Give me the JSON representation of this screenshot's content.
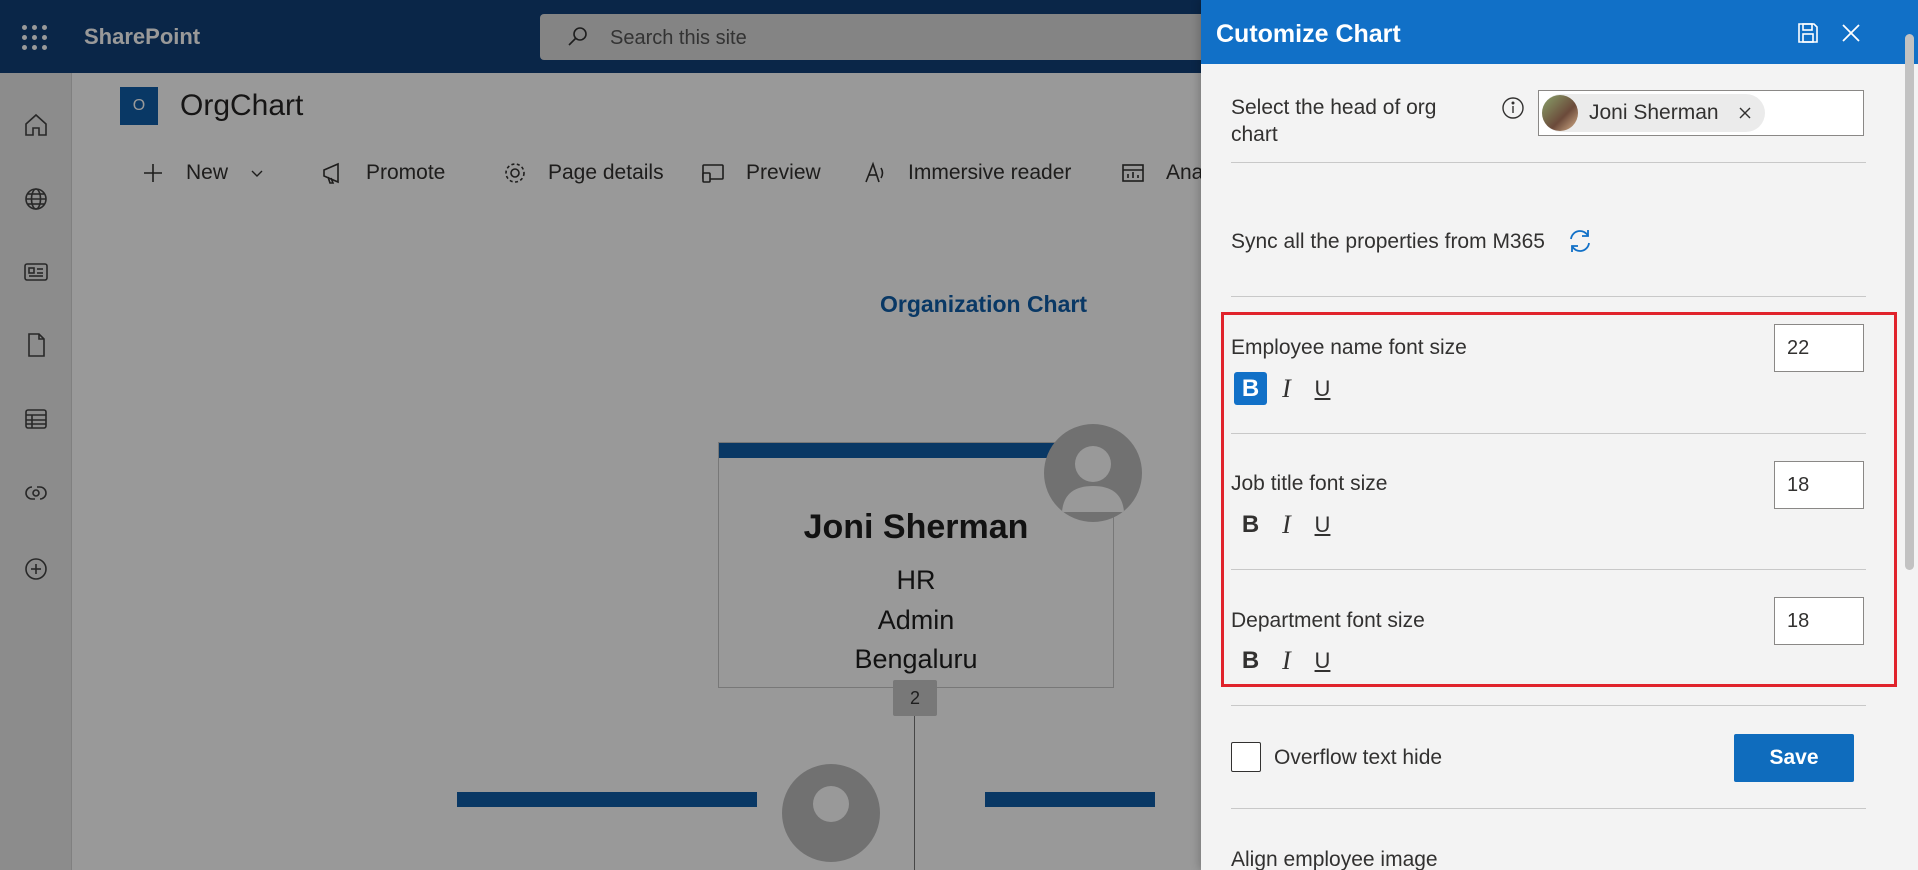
{
  "suite_bar": {
    "app_name": "SharePoint",
    "search_placeholder": "Search this site",
    "background_color": "#124078"
  },
  "left_rail": {
    "icons": [
      "home-icon",
      "globe-icon",
      "news-icon",
      "document-icon",
      "list-icon",
      "loop-icon",
      "add-icon"
    ]
  },
  "site": {
    "logo_letter": "O",
    "title": "OrgChart"
  },
  "command_bar": {
    "new_label": "New",
    "promote_label": "Promote",
    "page_details_label": "Page details",
    "preview_label": "Preview",
    "immersive_reader_label": "Immersive reader",
    "analytics_label": "Ana"
  },
  "org_chart": {
    "title": "Organization Chart",
    "root": {
      "name": "Joni Sherman",
      "job_title": "HR",
      "department": "Admin",
      "location": "Bengaluru",
      "reports_count": "2"
    }
  },
  "panel": {
    "title": "Cutomize Chart",
    "head_label": "Select the head of org chart",
    "head_label_line1": "Select the head of org",
    "head_label_line2": "chart",
    "head_selected": "Joni Sherman",
    "sync_label": "Sync all the properties from M365",
    "employee_name_label": "Employee name font size",
    "employee_name_size": "22",
    "employee_name_bold": true,
    "job_title_label": "Job title font size",
    "job_title_size": "18",
    "department_label": "Department font size",
    "department_size": "18",
    "format_bold": "B",
    "format_italic": "I",
    "format_underline": "U",
    "overflow_label": "Overflow text hide",
    "overflow_checked": false,
    "save_label": "Save",
    "align_image_label": "Align employee image",
    "accent_color": "#1170c7",
    "highlight_color": "#e0222b"
  }
}
